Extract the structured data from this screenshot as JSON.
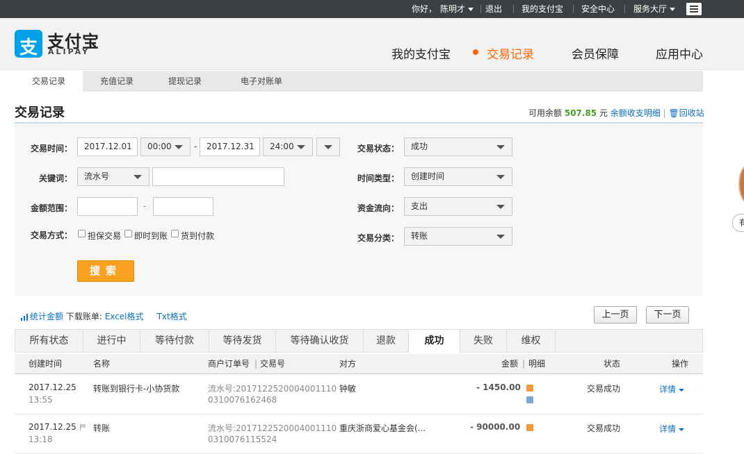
{
  "topbar": {
    "greeting": "你好，",
    "user_name": "陈明才",
    "logout": "退出",
    "my_alipay": "我的支付宝",
    "security": "安全中心",
    "service": "服务大厅"
  },
  "logo": {
    "mark": "支",
    "name": "支付宝",
    "sub": "ALIPAY"
  },
  "main_nav": [
    "我的支付宝",
    "交易记录",
    "会员保障",
    "应用中心"
  ],
  "sub_nav": [
    "交易记录",
    "充值记录",
    "提现记录",
    "电子对账单"
  ],
  "page": {
    "title": "交易记录",
    "balance_label": "可用余额",
    "balance_value": "507.85",
    "balance_unit": "元",
    "balance_detail": "余额收支明细",
    "separator": "|",
    "recycle": "回收站"
  },
  "filter": {
    "time_label": "交易时间：",
    "start_date": "2017.12.01",
    "start_time": "00:00",
    "dash": "-",
    "end_date": "2017.12.31",
    "end_time": "24:00",
    "keyword_label": "关键词：",
    "keyword_type": "流水号",
    "keyword_value": "",
    "amount_label": "金额范围：",
    "amount_min": "",
    "amount_max": "",
    "method_label": "交易方式：",
    "methods": [
      "担保交易",
      "即时到账",
      "货到付款"
    ],
    "status_label": "交易状态：",
    "status_value": "成功",
    "time_type_label": "时间类型：",
    "time_type_value": "创建时间",
    "flow_label": "资金流向：",
    "flow_value": "支出",
    "category_label": "交易分类：",
    "category_value": "转账",
    "search_button": "搜索"
  },
  "stats": {
    "total_amount": "统计金额",
    "download_label": "下载账单:",
    "excel": "Excel格式",
    "txt": "Txt格式"
  },
  "pager": {
    "prev": "上一页",
    "next": "下一页"
  },
  "tabs": [
    "所有状态",
    "进行中",
    "等待付款",
    "等待发货",
    "等待确认收货",
    "退款",
    "成功",
    "失败",
    "维权"
  ],
  "active_tab": "成功",
  "table": {
    "headers": {
      "created": "创建时间",
      "name": "名称",
      "merchant_order": "商户订单号",
      "trade_no": "交易号",
      "counterparty": "对方",
      "amount": "金额",
      "detail": "明细",
      "status": "状态",
      "action": "操作"
    },
    "rows": [
      {
        "date": "2017.12.25",
        "time": "13:55",
        "name": "转账到银行卡-小协货款",
        "serial_line1": "流水号:2017122520004001110",
        "serial_line2": "0310076162468",
        "counterparty": "钟敏",
        "amount": "- 1450.00",
        "status": "交易成功",
        "action": "详情"
      },
      {
        "date": "2017.12.25",
        "time": "13:18",
        "name": "转账",
        "serial_line1": "流水号:2017122520004001110",
        "serial_line2": "0310076115524",
        "counterparty": "重庆浙商爱心基金会(...",
        "amount": "- 90000.00",
        "status": "交易成功",
        "action": "详情"
      }
    ]
  },
  "side": {
    "tab": "有"
  },
  "colors": {
    "accent_orange": "#ff6600",
    "link_blue": "#0a6fbd",
    "balance_green": "#4a9d22",
    "search_orange": "#f7a11f"
  }
}
